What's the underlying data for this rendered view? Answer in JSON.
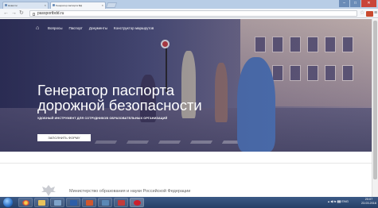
{
  "browser": {
    "tabs": [
      {
        "title": "Новости"
      },
      {
        "title": "Генератор паспорта БД"
      }
    ],
    "url": "passportbdd.ru",
    "window_controls": {
      "minimize": "–",
      "maximize": "□",
      "close": "✕"
    }
  },
  "nav": {
    "home_icon": "home-icon",
    "items": [
      "Вопросы",
      "Паспорт",
      "Документы",
      "Конструктор маршрутов"
    ]
  },
  "hero": {
    "title_line1": "Генератор паспорта",
    "title_line2": "дорожной безопасности",
    "subtitle": "УДОБНЫЙ ИНСТРУМЕНТ ДЛЯ СОТРУДНИКОВ ОБРАЗОВАТЕЛЬНЫХ ОРГАНИЗАЦИЙ",
    "button": "ЗАПОЛНИТЬ ФОРМУ"
  },
  "footer": {
    "ministry": "Министерство образования и науки Российской Федерации"
  },
  "taskbar": {
    "tray_lang": "ENG",
    "time": "20:07",
    "date": "23.03.2016"
  },
  "colors": {
    "hero_overlay": "#3b3d6b",
    "taskbar": "#2e4b76",
    "button_bg": "#ffffff"
  }
}
